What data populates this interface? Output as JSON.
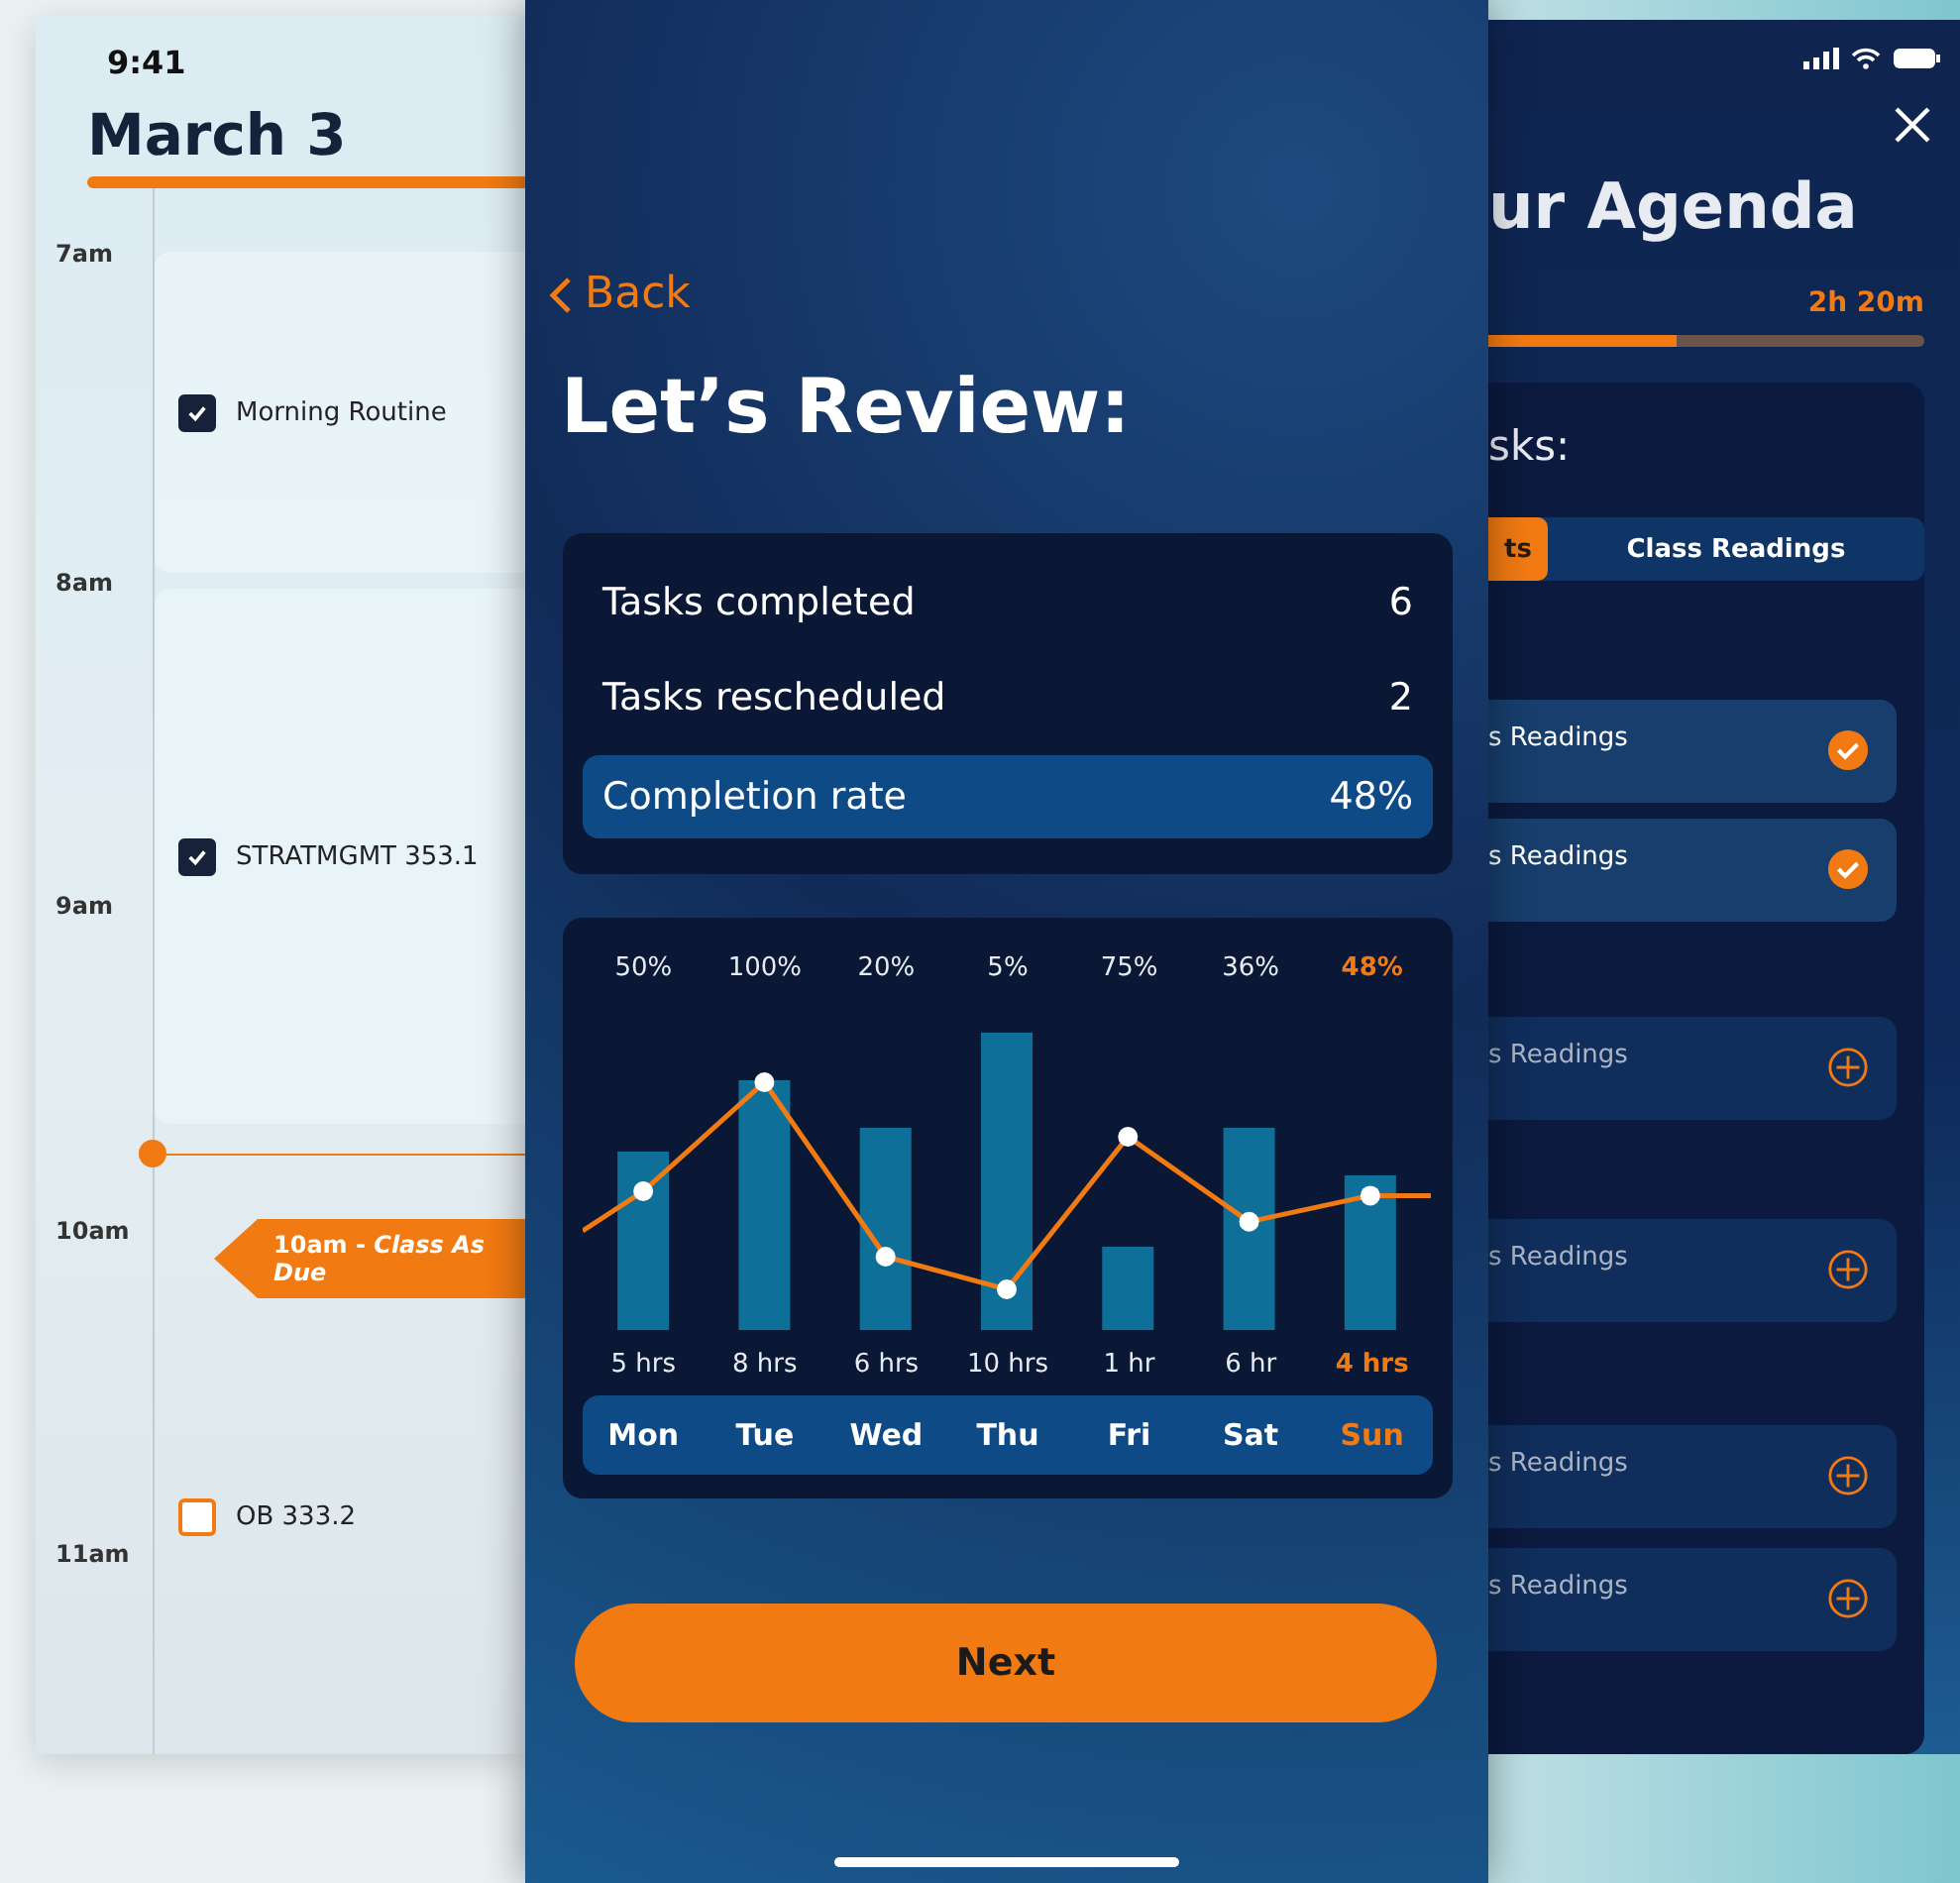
{
  "calendar_screen": {
    "time": "9:41",
    "title": "March 3",
    "hours": [
      "7am",
      "8am",
      "9am",
      "10am",
      "11am"
    ],
    "events": [
      {
        "title": "Morning Routine",
        "checked": true
      },
      {
        "title": "STRATMGMT 353.1",
        "checked": true
      },
      {
        "title": "OB 333.2",
        "checked": false
      }
    ],
    "deadline": {
      "line_1": "10am - *Class As*",
      "line_2": "Due"
    }
  },
  "review_screen": {
    "back": "Back",
    "title": "Let’s Review:",
    "stats": [
      {
        "label": "Tasks completed",
        "value": "6",
        "highlighted": false
      },
      {
        "label": "Tasks rescheduled",
        "value": "2",
        "highlighted": false
      },
      {
        "label": "Completion rate",
        "value": "48%",
        "highlighted": true
      }
    ],
    "days": [
      {
        "rate": "50%",
        "hours": "5 hrs",
        "day": "Mon",
        "selected": false
      },
      {
        "rate": "100%",
        "hours": "8 hrs",
        "day": "Tue",
        "selected": false
      },
      {
        "rate": "20%",
        "hours": "6 hrs",
        "day": "Wed",
        "selected": false
      },
      {
        "rate": "5%",
        "hours": "10 hrs",
        "day": "Thu",
        "selected": false
      },
      {
        "rate": "75%",
        "hours": "1 hr",
        "day": "Fri",
        "selected": false
      },
      {
        "rate": "36%",
        "hours": "6 hr",
        "day": "Sat",
        "selected": false
      },
      {
        "rate": "48%",
        "hours": "4 hrs",
        "day": "Sun",
        "selected": true
      }
    ],
    "next": "Next"
  },
  "agenda_screen": {
    "title": "ur Agenda",
    "time_left": "2h 20m",
    "level": 0.43,
    "section": "sks:",
    "tabs": [
      {
        "label": "ts",
        "selected": true
      },
      {
        "label": "Class Readings",
        "selected": false
      }
    ],
    "items": [
      {
        "title": "s Readings",
        "done": true
      },
      {
        "title": "s Readings",
        "done": true
      },
      {
        "title": "s Readings",
        "done": false
      },
      {
        "title": "s Readings",
        "done": false
      },
      {
        "title": "s Readings",
        "done": false
      },
      {
        "title": "s Readings",
        "done": false
      }
    ]
  }
}
